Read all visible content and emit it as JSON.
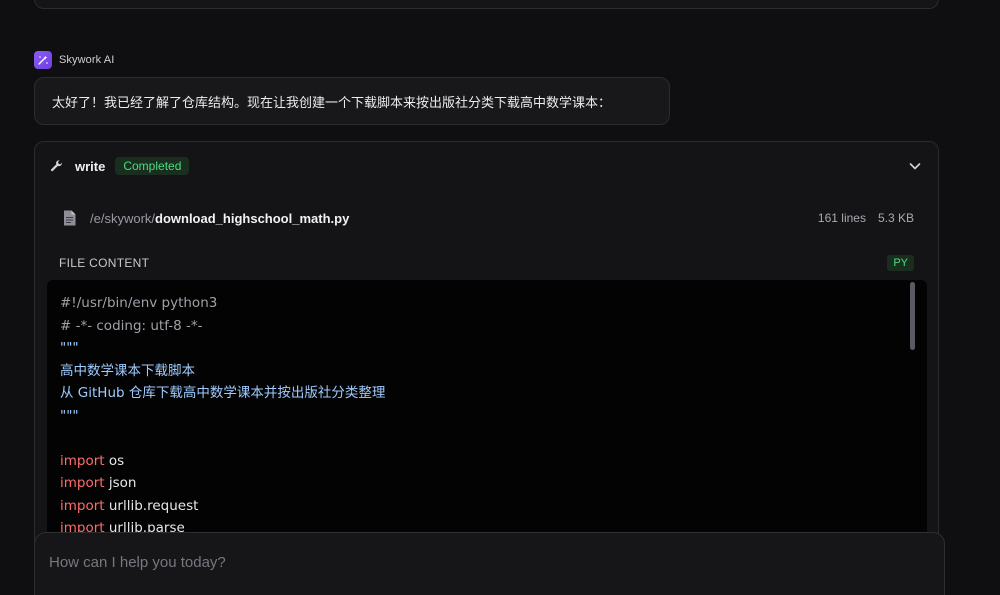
{
  "assistant": {
    "name": "Skywork AI",
    "message": "太好了！我已经了解了仓库结构。现在让我创建一个下载脚本来按出版社分类下载高中数学课本："
  },
  "tool": {
    "name": "write",
    "status": "Completed",
    "file": {
      "dir": "/e/skywork/",
      "name": "download_highschool_math.py",
      "lines": "161 lines",
      "size": "5.3 KB"
    },
    "content_label": "FILE CONTENT",
    "lang": "PY",
    "code_lines": [
      {
        "parts": [
          {
            "t": "#!/usr/bin/env python3",
            "c": "c-comment"
          }
        ]
      },
      {
        "parts": [
          {
            "t": "# -*- coding: utf-8 -*-",
            "c": "c-comment"
          }
        ]
      },
      {
        "parts": [
          {
            "t": "\"\"\"",
            "c": "c-string"
          }
        ]
      },
      {
        "parts": [
          {
            "t": "高中数学课本下载脚本",
            "c": "c-string"
          }
        ]
      },
      {
        "parts": [
          {
            "t": "从 GitHub 仓库下载高中数学课本并按出版社分类整理",
            "c": "c-string"
          }
        ]
      },
      {
        "parts": [
          {
            "t": "\"\"\"",
            "c": "c-string"
          }
        ]
      },
      {
        "parts": [
          {
            "t": "",
            "c": "c-plain"
          }
        ]
      },
      {
        "parts": [
          {
            "t": "import",
            "c": "c-kw"
          },
          {
            "t": " os",
            "c": "c-plain"
          }
        ]
      },
      {
        "parts": [
          {
            "t": "import",
            "c": "c-kw"
          },
          {
            "t": " json",
            "c": "c-plain"
          }
        ]
      },
      {
        "parts": [
          {
            "t": "import",
            "c": "c-kw"
          },
          {
            "t": " urllib.request",
            "c": "c-plain"
          }
        ]
      },
      {
        "parts": [
          {
            "t": "import",
            "c": "c-kw"
          },
          {
            "t": " urllib.parse",
            "c": "c-plain"
          }
        ]
      }
    ]
  },
  "chat_input": {
    "placeholder": "How can I help you today?"
  },
  "colors": {
    "accent_purple": "#8b5cf6",
    "success_green": "#4ade80",
    "keyword_red": "#ff6b6b",
    "string_blue": "#9ecbff"
  },
  "icons": {
    "avatar": "skywork-logo-icon",
    "tool": "wrench-icon",
    "collapse": "chevron-down-icon",
    "file": "file-icon"
  }
}
